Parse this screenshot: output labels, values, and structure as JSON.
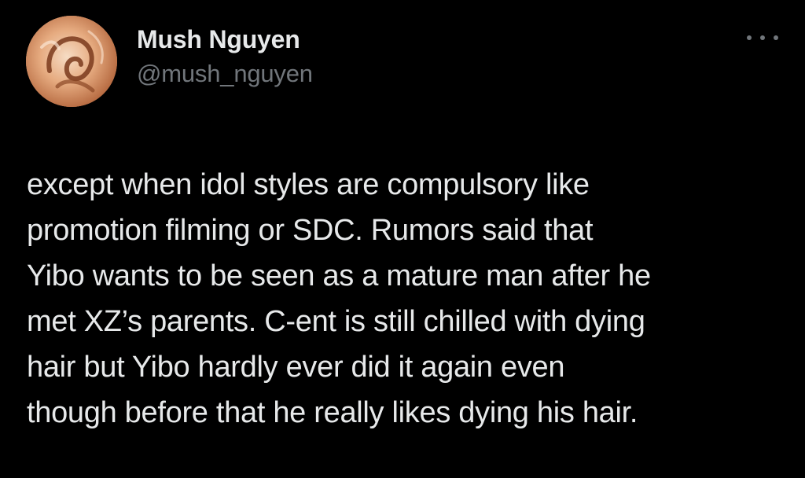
{
  "author": {
    "display_name": "Mush Nguyen",
    "handle": "@mush_nguyen",
    "avatar_icon": "profile-avatar"
  },
  "actions": {
    "more_icon": "more-options-icon"
  },
  "tweet": {
    "lines": [
      "except when idol styles are compulsory like",
      "promotion filming or SDC. Rumors said that",
      "Yibo wants to be seen as a mature man after he",
      "met XZ’s parents. C-ent is still chilled with dying",
      "hair but Yibo hardly ever did it again even",
      "though before that he really likes dying his hair."
    ]
  },
  "colors": {
    "background": "#000000",
    "text_primary": "#e7e9ea",
    "text_secondary": "#71767b"
  }
}
